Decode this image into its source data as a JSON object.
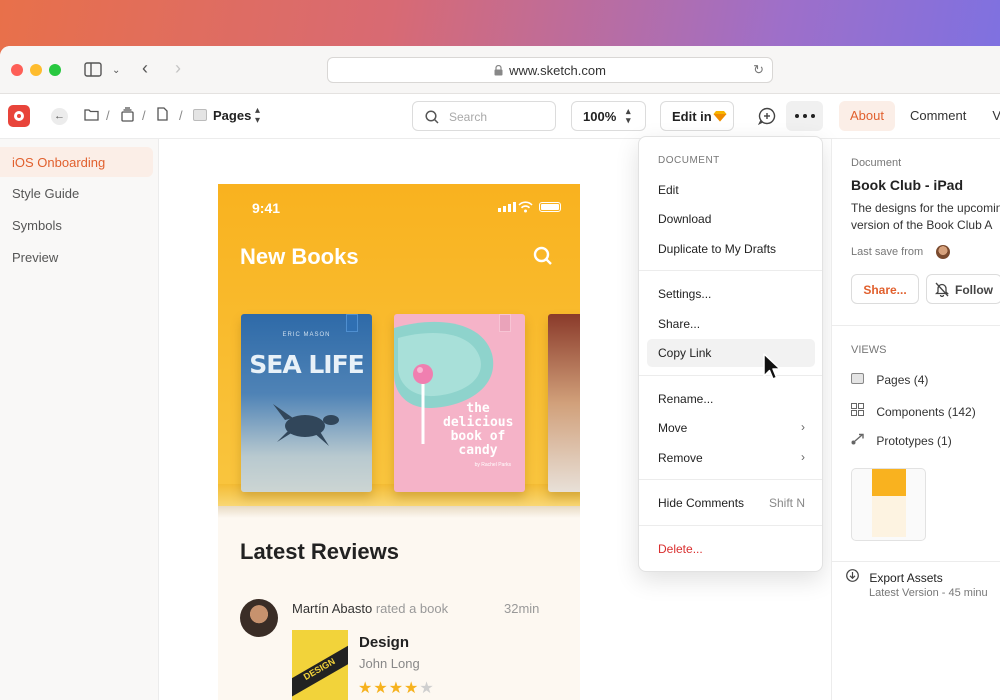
{
  "browser": {
    "url": "www.sketch.com"
  },
  "toolbar": {
    "breadcrumb_pages": "Pages",
    "search_placeholder": "Search",
    "zoom": "100%",
    "edit_in": "Edit in",
    "tabs": [
      "About",
      "Comment",
      "Ve"
    ]
  },
  "sidebar": {
    "items": [
      "iOS Onboarding",
      "Style Guide",
      "Symbols",
      "Preview"
    ]
  },
  "artboard": {
    "status_time": "9:41",
    "title": "New Books",
    "book1_subtitle": "ERIC MASON",
    "book1_title": "SEA LIFE",
    "book2_title": "the delicious book of candy",
    "book2_author": "by Rachel Parks",
    "latest_title": "Latest Reviews",
    "review": {
      "reviewer": "Martín Abasto",
      "action": "rated a book",
      "time": "32min",
      "book_title": "Design",
      "author": "John Long",
      "cover_text": "DESIGN",
      "rating": 4,
      "max_rating": 5
    }
  },
  "menu": {
    "header": "DOCUMENT",
    "items": {
      "edit": "Edit",
      "download": "Download",
      "duplicate": "Duplicate to My Drafts",
      "settings": "Settings...",
      "share": "Share...",
      "copy_link": "Copy Link",
      "rename": "Rename...",
      "move": "Move",
      "remove": "Remove",
      "hide_comments": "Hide Comments",
      "hide_comments_shortcut": "Shift N",
      "delete": "Delete..."
    }
  },
  "right_panel": {
    "section_label": "Document",
    "title": "Book Club - iPad",
    "description": "The designs for the upcoming version of the Book Club A",
    "last_save": "Last save from",
    "share_label": "Share...",
    "follow_label": "Follow",
    "views_label": "VIEWS",
    "views": [
      "Pages (4)",
      "Components (142)",
      "Prototypes (1)"
    ],
    "export_label": "Export Assets",
    "export_sub": "Latest Version - 45 minu"
  },
  "colors": {
    "accent": "#e1602e",
    "danger": "#d92e2e",
    "artboard_yellow": "#f9b21f"
  }
}
